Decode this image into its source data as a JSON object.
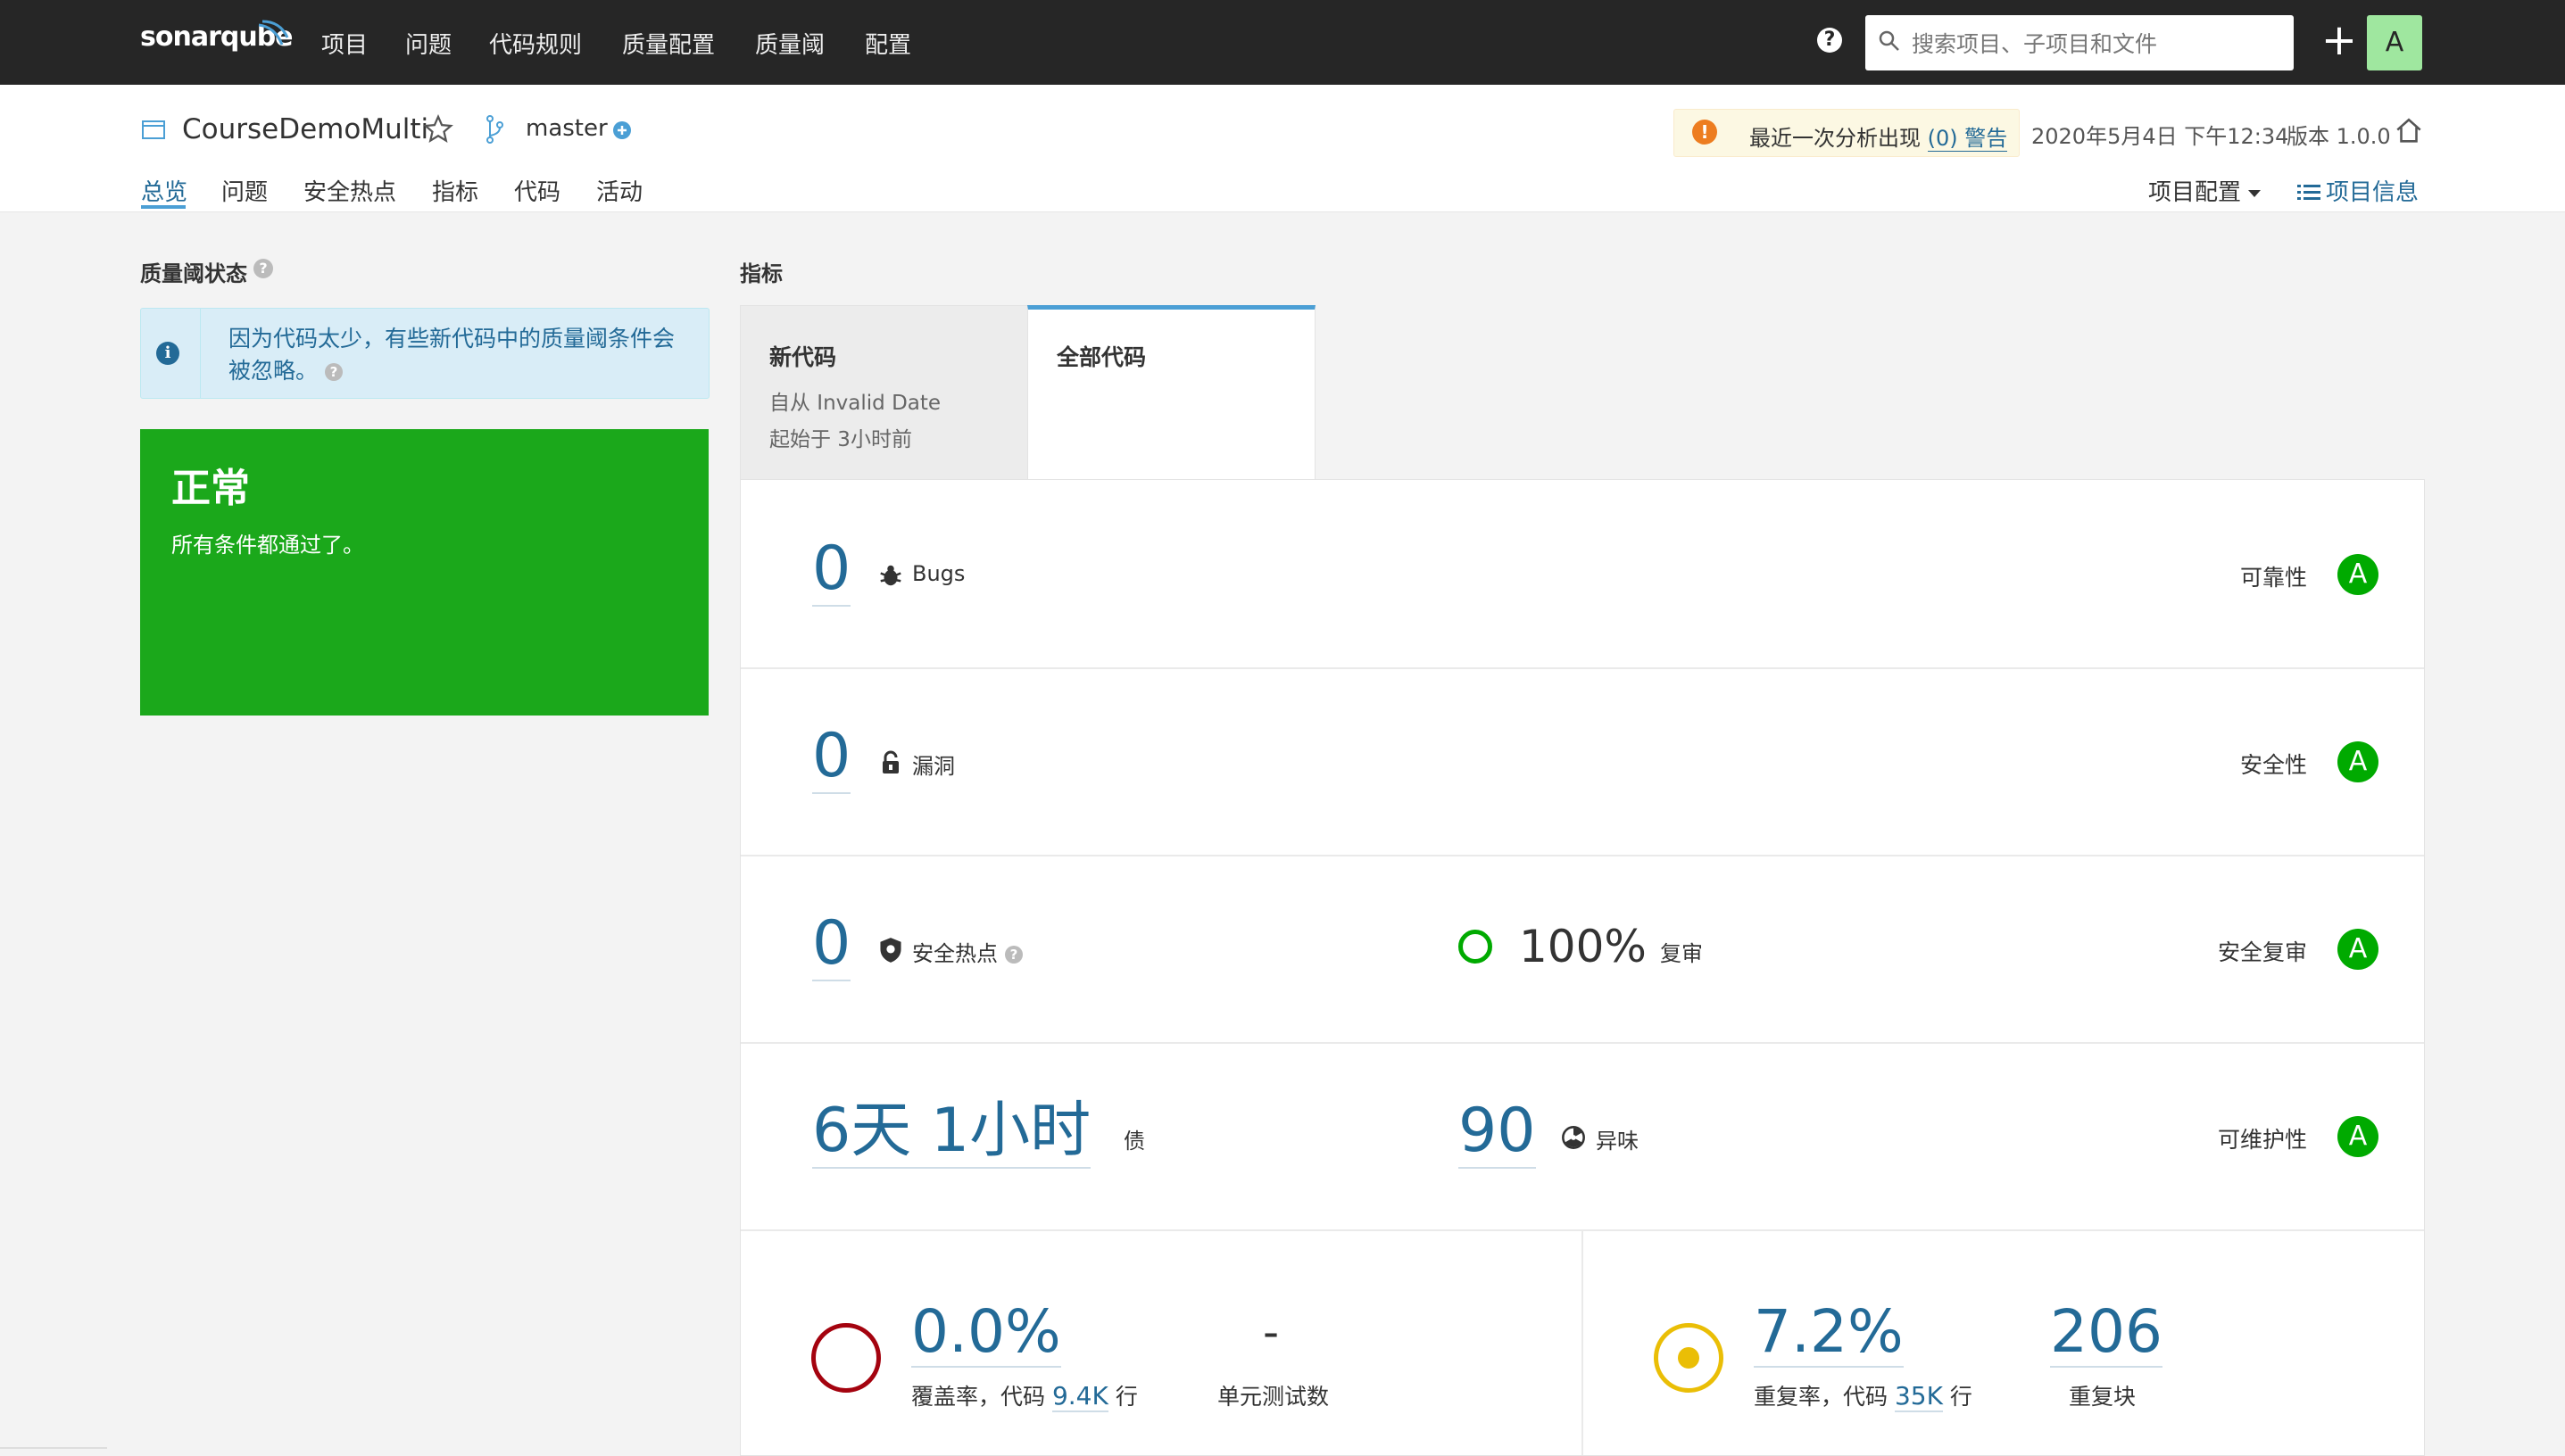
{
  "nav": {
    "logo": "sonarqube",
    "items": [
      "项目",
      "问题",
      "代码规则",
      "质量配置",
      "质量阈",
      "配置"
    ],
    "help": "?",
    "search_placeholder": "搜索项目、子项目和文件",
    "add": "+",
    "avatar": "A"
  },
  "project": {
    "name": "CourseDemoMulti",
    "branch": "master",
    "warning_prefix": "最近一次分析出现",
    "warning_link": "(0) 警告",
    "analysis_date": "2020年5月4日 下午12:34",
    "version": "版本 1.0.0",
    "tabs": [
      "总览",
      "问题",
      "安全热点",
      "指标",
      "代码",
      "活动"
    ],
    "settings": "项目配置",
    "info": "项目信息"
  },
  "quality_gate": {
    "title": "质量阈状态",
    "info_message": "因为代码太少，有些新代码中的质量阈条件会被忽略。",
    "status": "正常",
    "status_message": "所有条件都通过了。"
  },
  "measures": {
    "title": "指标",
    "tab_new": {
      "title": "新代码",
      "line1": "自从 Invalid Date",
      "line2": "起始于 3小时前"
    },
    "tab_all": {
      "title": "全部代码"
    },
    "bugs": {
      "value": "0",
      "label": "Bugs",
      "rating_label": "可靠性",
      "rating": "A"
    },
    "vulnerabilities": {
      "value": "0",
      "label": "漏洞",
      "rating_label": "安全性",
      "rating": "A"
    },
    "hotspots": {
      "value": "0",
      "label": "安全热点",
      "reviewed": "100%",
      "reviewed_label": "复审",
      "rating_label": "安全复审",
      "rating": "A"
    },
    "debt": {
      "value": "6天 1小时",
      "label": "债",
      "smells": "90",
      "smells_label": "异味",
      "rating_label": "可维护性",
      "rating": "A"
    },
    "coverage": {
      "value": "0.0%",
      "label_prefix": "覆盖率，代码",
      "lines": "9.4K",
      "label_suffix": "行",
      "tests": "-",
      "tests_label": "单元测试数"
    },
    "duplications": {
      "value": "7.2%",
      "label_prefix": "重复率，代码",
      "lines": "35K",
      "label_suffix": "行",
      "blocks": "206",
      "blocks_label": "重复块"
    }
  },
  "colors": {
    "topbar": "#262626",
    "link": "#236a97",
    "passed": "#1ba81b",
    "rating_a": "#00aa00",
    "coverage_ring": "#a4030f",
    "duplication_ring": "#eabe06"
  }
}
